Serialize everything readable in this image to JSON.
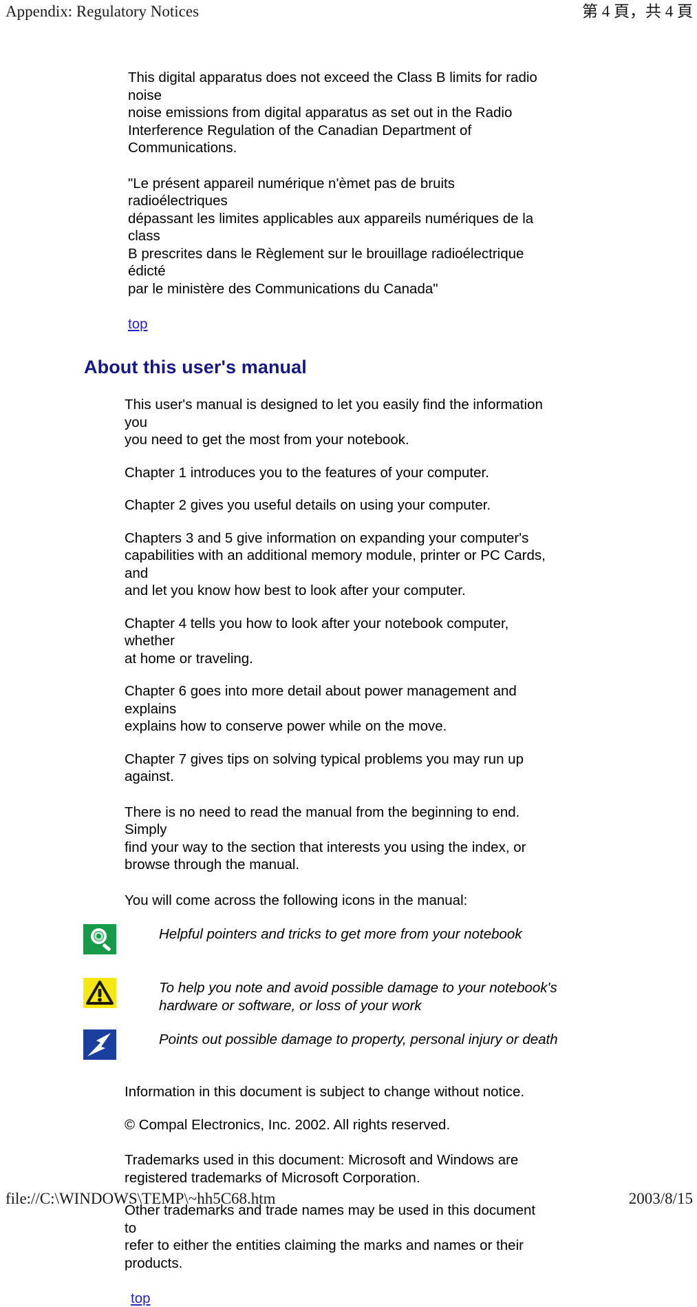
{
  "print_header": {
    "left": "Appendix: Regulatory Notices",
    "right": "第 4 頁，共 4 頁"
  },
  "print_footer": {
    "left": "file://C:\\WINDOWS\\TEMP\\~hh5C68.htm",
    "right": "2003/8/15"
  },
  "regulatory": {
    "paragraph_en": "This digital apparatus does not exceed the Class B limits for radio noise\nnoise emissions from digital apparatus as set out in the Radio\nInterference Regulation of the Canadian Department of\nCommunications.",
    "paragraph_fr": "\"Le présent appareil numérique n'èmet pas de bruits radioélectriques\ndépassant les limites applicables aux appareils numériques de la class\nB prescrites dans le Règlement sur le brouillage radioélectrique édicté\npar le ministère des Communications du Canada\"",
    "top_link": "top"
  },
  "about_manual": {
    "heading": "About this user's manual",
    "heading_color": "#171787",
    "link_color": "#2222cc",
    "intro": "This user's manual is designed to let you easily find the information you\nyou need to get the most from your notebook.",
    "chapter1": "Chapter 1 introduces you to the features of your computer.",
    "chapter2": "Chapter 2 gives you useful details on using your computer.",
    "chapter3_5": "Chapters 3 and 5 give information on expanding your computer's\ncapabilities with an additional memory module, printer or PC Cards, and\nand let you know how best to look after your computer.",
    "chapter4": "Chapter 4 tells you how to look after your notebook computer, whether\nat home or traveling.",
    "chapter6": "Chapter 6 goes into more detail about power management and explains\nexplains how to conserve power while on the move.",
    "chapter7": "Chapter 7 gives tips on solving typical problems you may run up\nagainst.",
    "no_need": "There is no need to read the manual from the beginning to end. Simply\nfind your way to the section that interests you using the index, or\nbrowse through the manual.",
    "icons_intro": "You will come across the following icons in the manual:",
    "icons": [
      {
        "icon_name": "tip-magnifier-icon",
        "icon_color": "#179a4a",
        "caption": "Helpful pointers and tricks to get more from your notebook"
      },
      {
        "icon_name": "caution-warning-triangle-icon",
        "icon_color": "#f5e616",
        "caption": "To help you note and avoid possible damage to your notebook's\nhardware or software, or loss of your work"
      },
      {
        "icon_name": "danger-lightning-bolt-icon",
        "icon_color": "#1b3f9e",
        "caption": "Points out possible damage to property, personal injury or death"
      }
    ],
    "notice_change": "Information in this document is subject to change without notice.",
    "copyright": "© Compal Electronics, Inc. 2002. All rights reserved.",
    "trademarks": "Trademarks used in this document: Microsoft and Windows are\nregistered trademarks of Microsoft Corporation.",
    "other_trademarks": "Other trademarks and trade names may be used in this document to\nrefer to either the entities claiming the marks and names or their\nproducts.",
    "top_link": "top"
  }
}
